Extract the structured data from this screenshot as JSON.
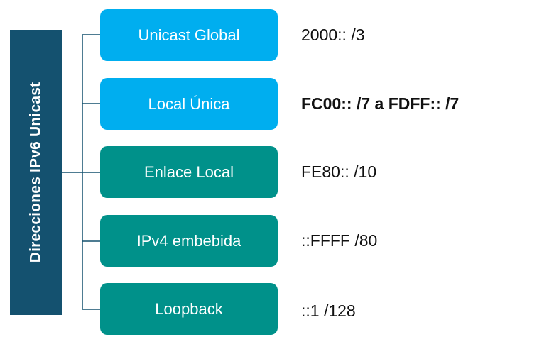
{
  "root": {
    "label": "Direcciones IPv6 Unicast"
  },
  "colors": {
    "root": "#14516f",
    "blue": "#00aeef",
    "teal": "#00918a",
    "line": "#14516f"
  },
  "items": [
    {
      "label": "Unicast Global",
      "value": "2000:: /3",
      "style": "blue",
      "bold": false
    },
    {
      "label": "Local Única",
      "value": "FC00:: /7 a FDFF:: /7",
      "style": "blue",
      "bold": true
    },
    {
      "label": "Enlace Local",
      "value": "FE80:: /10",
      "style": "teal",
      "bold": false
    },
    {
      "label": "IPv4 embebida",
      "value": "::FFFF /80",
      "style": "teal",
      "bold": false
    },
    {
      "label": "Loopback",
      "value": "::1 /128",
      "style": "teal",
      "bold": false
    }
  ]
}
